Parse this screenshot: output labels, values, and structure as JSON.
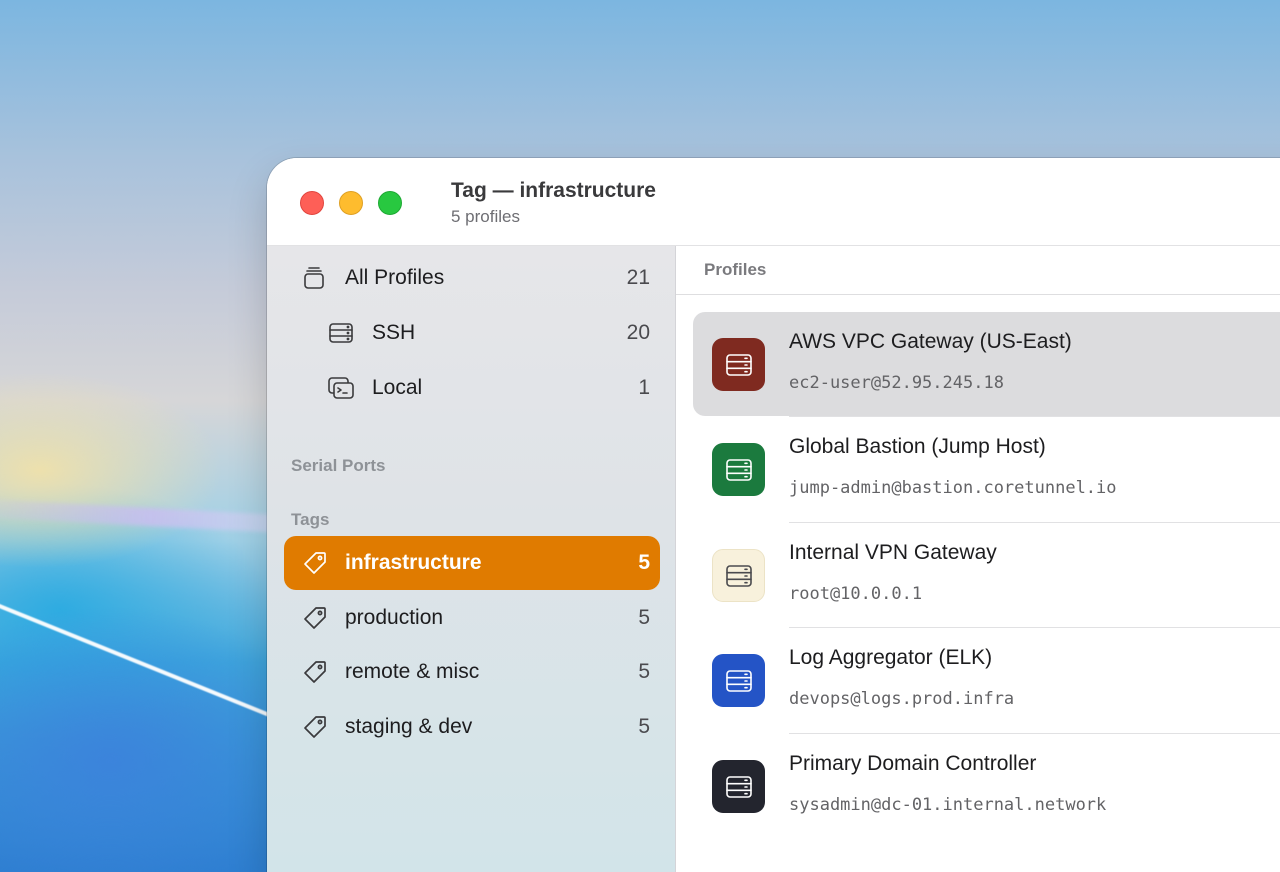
{
  "window": {
    "title": "Tag — infrastructure",
    "subtitle": "5 profiles"
  },
  "sidebar": {
    "items": [
      {
        "label": "All Profiles",
        "count": "21",
        "icon": "stack-icon"
      },
      {
        "label": "SSH",
        "count": "20",
        "icon": "server-icon"
      },
      {
        "label": "Local",
        "count": "1",
        "icon": "terminal-window-icon"
      }
    ],
    "serial_ports_header": "Serial Ports",
    "tags_header": "Tags",
    "tags": [
      {
        "label": "infrastructure",
        "count": "5",
        "selected": true
      },
      {
        "label": "production",
        "count": "5",
        "selected": false
      },
      {
        "label": "remote & misc",
        "count": "5",
        "selected": false
      },
      {
        "label": "staging & dev",
        "count": "5",
        "selected": false
      }
    ]
  },
  "main": {
    "header": "Profiles",
    "profiles": [
      {
        "name": "AWS VPC Gateway (US-East)",
        "address": "ec2-user@52.95.245.18",
        "color": "#7f2a20",
        "selected": true
      },
      {
        "name": "Global Bastion (Jump Host)",
        "address": "jump-admin@bastion.coretunnel.io",
        "color": "#1b7a3e",
        "selected": false
      },
      {
        "name": "Internal VPN Gateway",
        "address": "root@10.0.0.1",
        "color": "#f8f1dc",
        "selected": false
      },
      {
        "name": "Log Aggregator (ELK)",
        "address": "devops@logs.prod.infra",
        "color": "#2454c6",
        "selected": false
      },
      {
        "name": "Primary Domain Controller",
        "address": "sysadmin@dc-01.internal.network",
        "color": "#23252e",
        "selected": false
      }
    ]
  },
  "colors": {
    "accent": "#e07b00",
    "close": "#fe5f57",
    "minimize": "#febc2e",
    "zoom": "#28c840"
  }
}
